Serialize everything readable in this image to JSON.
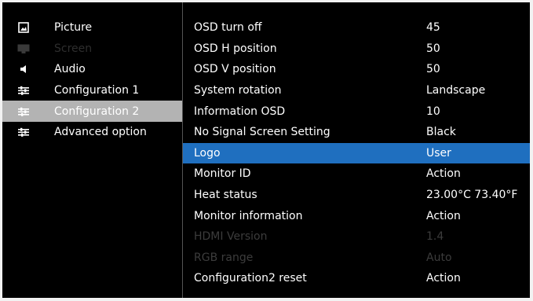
{
  "left_menu": [
    {
      "label": "Picture",
      "icon": "picture-icon",
      "state": "normal"
    },
    {
      "label": "Screen",
      "icon": "screen-icon",
      "state": "disabled"
    },
    {
      "label": "Audio",
      "icon": "speaker-icon",
      "state": "normal"
    },
    {
      "label": "Configuration 1",
      "icon": "sliders-icon",
      "state": "normal"
    },
    {
      "label": "Configuration 2",
      "icon": "sliders-icon",
      "state": "selected"
    },
    {
      "label": "Advanced option",
      "icon": "sliders-icon",
      "state": "normal"
    }
  ],
  "settings": [
    {
      "label": "OSD turn off",
      "value": "45",
      "state": "normal"
    },
    {
      "label": "OSD H position",
      "value": "50",
      "state": "normal"
    },
    {
      "label": "OSD V position",
      "value": "50",
      "state": "normal"
    },
    {
      "label": "System rotation",
      "value": "Landscape",
      "state": "normal"
    },
    {
      "label": "Information OSD",
      "value": "10",
      "state": "normal"
    },
    {
      "label": "No Signal Screen Setting",
      "value": "Black",
      "state": "normal"
    },
    {
      "label": "Logo",
      "value": "User",
      "state": "selected"
    },
    {
      "label": "Monitor ID",
      "value": "Action",
      "state": "normal"
    },
    {
      "label": "Heat status",
      "value": "23.00°C 73.40°F",
      "state": "normal"
    },
    {
      "label": "Monitor information",
      "value": "Action",
      "state": "normal"
    },
    {
      "label": "HDMI Version",
      "value": "1.4",
      "state": "disabled"
    },
    {
      "label": "RGB range",
      "value": "Auto",
      "state": "disabled"
    },
    {
      "label": "Configuration2 reset",
      "value": "Action",
      "state": "normal"
    }
  ],
  "colors": {
    "background": "#000000",
    "selected_left": "#b3b3b3",
    "selected_right": "#1f6fbf",
    "text": "#ffffff",
    "disabled_text": "#3c3c3c"
  }
}
